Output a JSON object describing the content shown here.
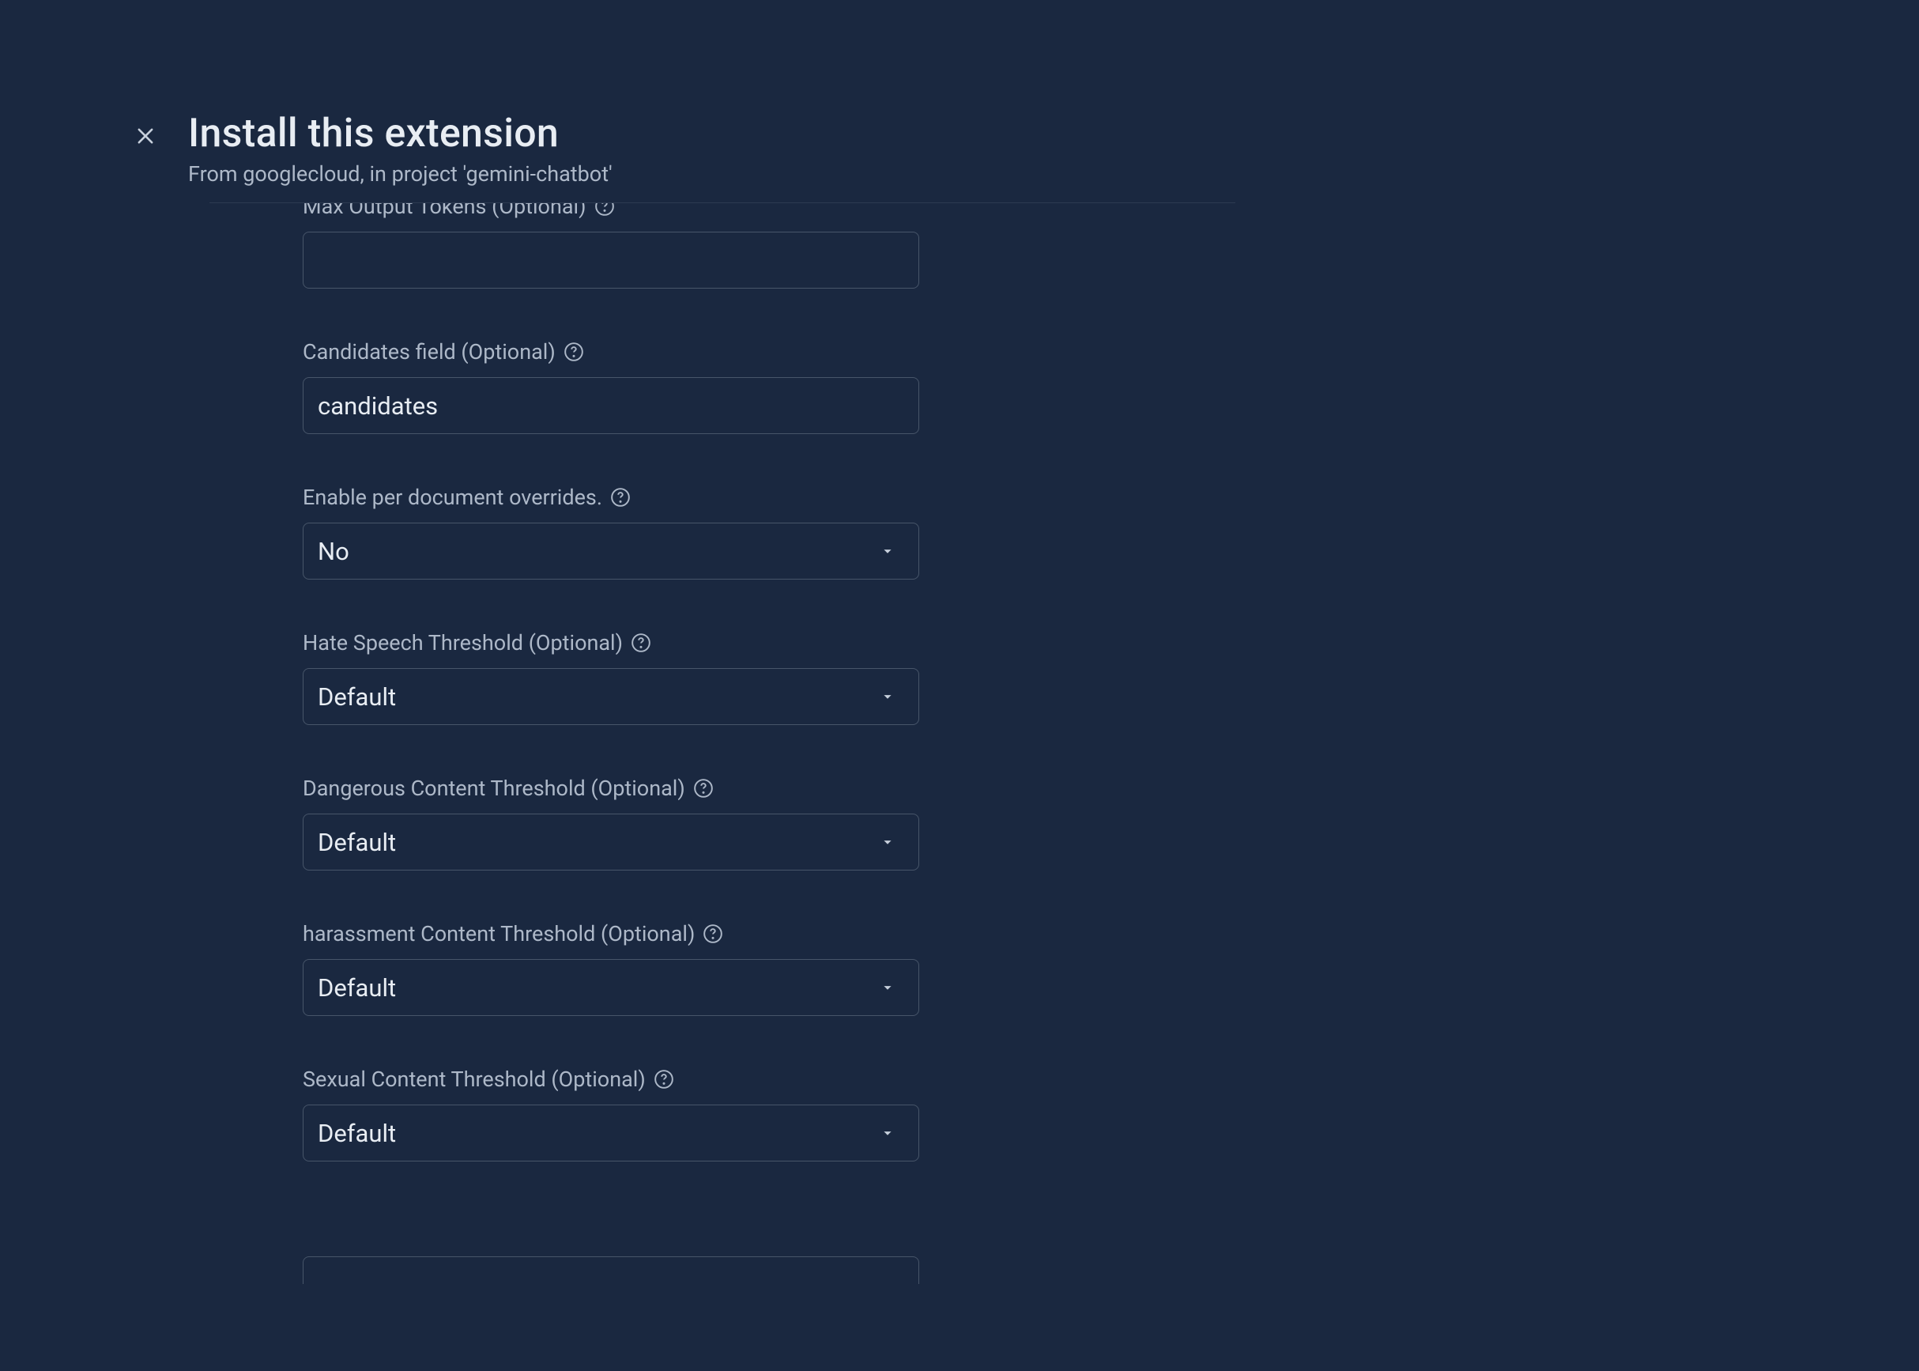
{
  "header": {
    "title": "Install this extension",
    "subtitle": "From googlecloud, in project 'gemini-chatbot'"
  },
  "fields": {
    "maxOutputTokens": {
      "label": "Max Output Tokens (Optional)",
      "value": ""
    },
    "candidatesField": {
      "label": "Candidates field (Optional)",
      "value": "candidates"
    },
    "enableOverrides": {
      "label": "Enable per document overrides.",
      "value": "No"
    },
    "hateSpeech": {
      "label": "Hate Speech Threshold (Optional)",
      "value": "Default"
    },
    "dangerousContent": {
      "label": "Dangerous Content Threshold (Optional)",
      "value": "Default"
    },
    "harassmentContent": {
      "label": "harassment Content Threshold (Optional)",
      "value": "Default"
    },
    "sexualContent": {
      "label": "Sexual Content Threshold (Optional)",
      "value": "Default"
    }
  }
}
